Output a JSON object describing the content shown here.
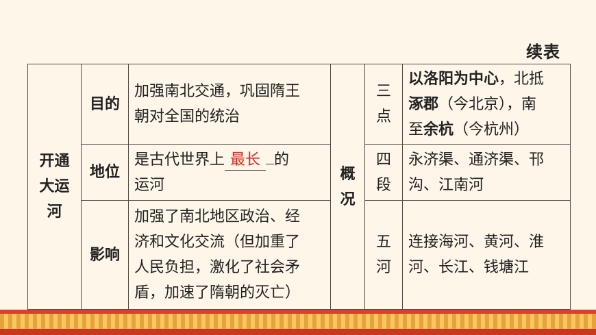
{
  "continued_label": "续表",
  "table": {
    "topic_label": [
      "开通",
      "大运",
      "河"
    ],
    "purpose": {
      "header": "目的",
      "lines": [
        "加强南北交通，巩固隋王",
        "朝对全国的统治"
      ]
    },
    "status": {
      "header": "地位",
      "line1_prefix": "是古代世界上",
      "answer": "最长",
      "line1_suffix": "的",
      "line2": "运河"
    },
    "impact": {
      "header": "影响",
      "lines": [
        "加强了南北地区政治、经",
        "济和文化交流（但加重了",
        "人民负担，激化了社会矛",
        "盾，加速了隋朝的灭亡）"
      ]
    },
    "overview_label": [
      "概",
      "况"
    ],
    "three_points": {
      "header": [
        "三",
        "点"
      ],
      "line1_bold": "以洛阳为中心",
      "line1_rest": "，北抵",
      "line2_bold": "涿郡",
      "line2_rest": "（今北京），南",
      "line3_prefix": "至",
      "line3_bold": "余杭",
      "line3_rest": "（今杭州）"
    },
    "four_sections": {
      "header": [
        "四",
        "段"
      ],
      "lines": [
        "永济渠、通济渠、邗",
        "沟、江南河"
      ]
    },
    "five_rivers": {
      "header": [
        "五",
        "河"
      ],
      "lines": [
        "连接海河、黄河、淮",
        "河、长江、钱塘江"
      ]
    }
  }
}
